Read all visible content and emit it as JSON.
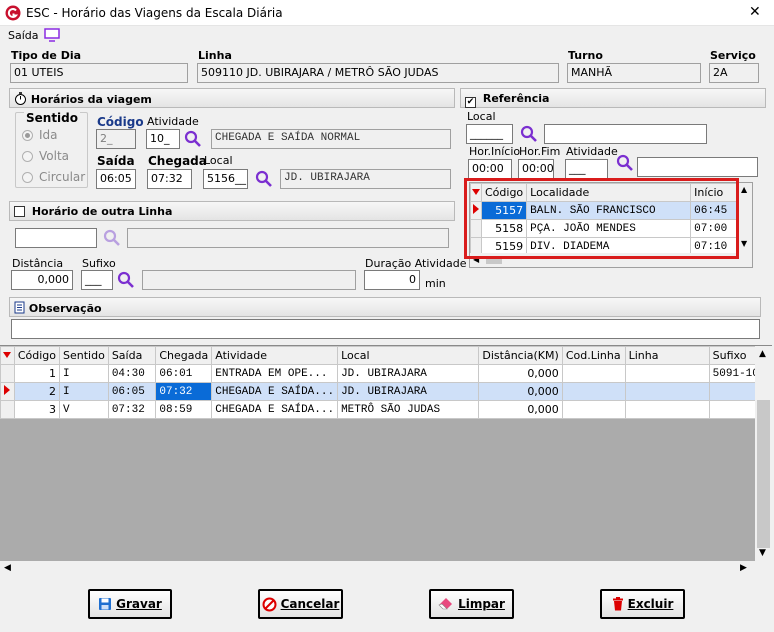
{
  "window": {
    "title": "ESC - Horário das Viagens da Escala Diária",
    "close": "✕"
  },
  "menu": {
    "saida": "Saída"
  },
  "header": {
    "tipo_dia": {
      "label": "Tipo de Dia",
      "value": "01 UTEIS"
    },
    "linha": {
      "label": "Linha",
      "value": "509110 JD. UBIRAJARA / METRÔ SÃO JUDAS"
    },
    "turno": {
      "label": "Turno",
      "value": "MANHÃ"
    },
    "servico": {
      "label": "Serviço",
      "value": "2A"
    }
  },
  "horarios": {
    "title": "Horários da viagem",
    "sentido": {
      "label": "Sentido",
      "options": [
        "Ida",
        "Volta",
        "Circular"
      ]
    },
    "codigo": {
      "label": "Código",
      "value": "2_"
    },
    "atividade": {
      "label": "Atividade",
      "value": "10_",
      "desc": "CHEGADA E SAÍDA NORMAL"
    },
    "saida": {
      "label": "Saída",
      "value": "06:05"
    },
    "chegada": {
      "label": "Chegada",
      "value": "07:32"
    },
    "local": {
      "label": "Local",
      "value": "5156__",
      "desc": "JD. UBIRAJARA"
    }
  },
  "outra_linha": {
    "title": "Horário de outra Linha"
  },
  "distancia": {
    "label": "Distância",
    "value": "0,000"
  },
  "sufixo": {
    "label": "Sufixo",
    "value": "___"
  },
  "duracao": {
    "label": "Duração Atividade",
    "value": "0",
    "unit": "min"
  },
  "observacao": {
    "title": "Observação"
  },
  "referencia": {
    "title": "Referência",
    "local_label": "Local",
    "local_value": "______",
    "hor_inicio": {
      "label": "Hor.Início",
      "value": "00:00"
    },
    "hor_fim": {
      "label": "Hor.Fim",
      "value": "00:00"
    },
    "atividade": {
      "label": "Atividade",
      "value": "___"
    },
    "grid": {
      "columns": [
        "Código",
        "Localidade",
        "Início"
      ],
      "rows": [
        [
          "5157",
          "BALN. SÃO FRANCISCO",
          "06:45"
        ],
        [
          "5158",
          "PÇA. JOÃO MENDES",
          "07:00"
        ],
        [
          "5159",
          "DIV. DIADEMA",
          "07:10"
        ]
      ]
    }
  },
  "main_grid": {
    "columns": [
      "Código",
      "Sentido",
      "Saída",
      "Chegada",
      "Atividade",
      "Local",
      "Distância(KM)",
      "Cod.Linha",
      "Linha",
      "Sufixo"
    ],
    "rows": [
      [
        "1",
        "I",
        "04:30",
        "06:01",
        "ENTRADA EM OPE...",
        "JD. UBIRAJARA",
        "0,000",
        "",
        "",
        "5091-10"
      ],
      [
        "2",
        "I",
        "06:05",
        "07:32",
        "CHEGADA E SAÍDA...",
        "JD. UBIRAJARA",
        "0,000",
        "",
        "",
        ""
      ],
      [
        "3",
        "V",
        "07:32",
        "08:59",
        "CHEGADA E SAÍDA...",
        "METRÔ SÃO JUDAS",
        "0,000",
        "",
        "",
        ""
      ]
    ]
  },
  "buttons": {
    "gravar": "Gravar",
    "cancelar": "Cancelar",
    "limpar": "Limpar",
    "excluir": "Excluir"
  },
  "colors": {
    "accent": "#0a6bd7",
    "selection": "#cfe0f8",
    "highlight_box": "#d91c1c",
    "icon_purple": "#7b2fd0"
  }
}
